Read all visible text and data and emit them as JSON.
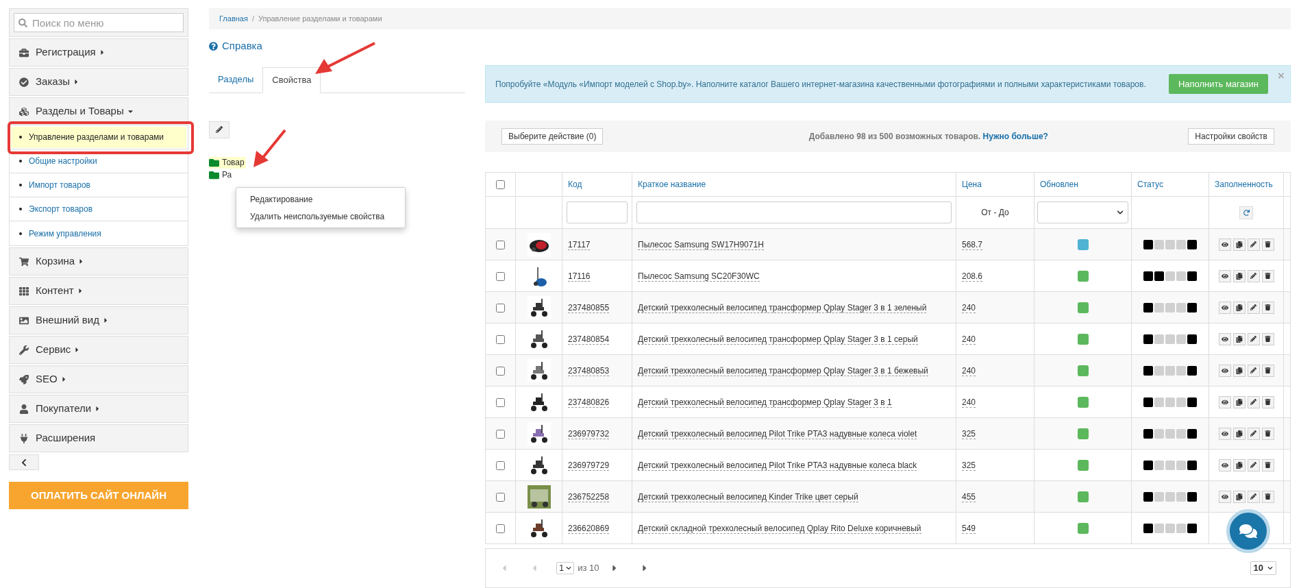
{
  "sidebar": {
    "search_placeholder": "Поиск по меню",
    "items": [
      {
        "label": "Регистрация",
        "expanded": false
      },
      {
        "label": "Заказы",
        "expanded": false
      },
      {
        "label": "Разделы и Товары",
        "expanded": true,
        "children": [
          {
            "label": "Управление разделами и товарами",
            "selected": true
          },
          {
            "label": "Общие настройки",
            "selected": false
          },
          {
            "label": "Импорт товаров",
            "selected": false
          },
          {
            "label": "Экспорт товаров",
            "selected": false
          },
          {
            "label": "Режим управления",
            "selected": false
          }
        ]
      },
      {
        "label": "Корзина",
        "expanded": false
      },
      {
        "label": "Контент",
        "expanded": false
      },
      {
        "label": "Внешний вид",
        "expanded": false
      },
      {
        "label": "Сервис",
        "expanded": false
      },
      {
        "label": "SEO",
        "expanded": false
      },
      {
        "label": "Покупатели",
        "expanded": false
      },
      {
        "label": "Расширения"
      }
    ],
    "pay_button": "ОПЛАТИТЬ САЙТ ОНЛАЙН"
  },
  "breadcrumb": {
    "separator": "/",
    "items": [
      "Главная",
      "Управление разделами и товарами"
    ]
  },
  "help_link": "Справка",
  "tabs": [
    {
      "label": "Разделы",
      "selected": false
    },
    {
      "label": "Свойства",
      "selected": true
    }
  ],
  "tree": [
    {
      "label": "Товар",
      "selected": true
    },
    {
      "label": "Ра",
      "selected": false
    }
  ],
  "context_menu": [
    "Редактирование",
    "Удалить неиспользуемые свойства"
  ],
  "banner": {
    "text": "Попробуйте «Модуль «Импорт моделей с Shop.by». Наполните каталог Вашего интернет-магазина качественными фотографиями и полными характеристиками товаров.",
    "button": "Наполнить магазин",
    "close": "×"
  },
  "action_bar": {
    "action_button": "Выберите действие (0)",
    "info": "Добавлено 98 из 500 возможных товаров.",
    "link": "Нужно больше?",
    "settings_button": "Настройки свойств"
  },
  "table": {
    "columns": [
      "Код",
      "Краткое название",
      "Цена",
      "Обновлен",
      "Статус",
      "Заполненность"
    ],
    "select_all_checked": false,
    "price_filter": "От - До",
    "rows": [
      {
        "checked": false,
        "code": "17117",
        "name": "Пылесос Samsung SW17H9071H",
        "price": "568.7",
        "color": "#4fb3d3",
        "status": [
          true,
          false,
          false,
          false,
          true
        ]
      },
      {
        "checked": false,
        "code": "17116",
        "name": "Пылесос Samsung SC20F30WC",
        "price": "208.6",
        "color": "#5cb85c",
        "status": [
          true,
          true,
          false,
          false,
          true
        ]
      },
      {
        "checked": false,
        "code": "237480855",
        "name": "Детский трехколесный велосипед трансформер Qplay Stager 3 в 1 зеленый",
        "price": "240",
        "color": "#5cb85c",
        "status": [
          true,
          false,
          false,
          false,
          true
        ]
      },
      {
        "checked": false,
        "code": "237480854",
        "name": "Детский трехколесный велосипед трансформер Qplay Stager 3 в 1 серый",
        "price": "240",
        "color": "#5cb85c",
        "status": [
          true,
          false,
          false,
          false,
          true
        ]
      },
      {
        "checked": false,
        "code": "237480853",
        "name": "Детский трехколесный велосипед трансформер Qplay Stager 3 в 1 бежевый",
        "price": "240",
        "color": "#5cb85c",
        "status": [
          true,
          false,
          false,
          false,
          true
        ]
      },
      {
        "checked": false,
        "code": "237480826",
        "name": "Детский трехколесный велосипед трансформер Qplay Stager 3 в 1",
        "price": "240",
        "color": "#5cb85c",
        "status": [
          true,
          false,
          false,
          false,
          true
        ]
      },
      {
        "checked": false,
        "code": "236979732",
        "name": "Детский трехколесный велосипед Pilot Trike PTA3 надувные колеса violet",
        "price": "325",
        "color": "#5cb85c",
        "status": [
          true,
          false,
          false,
          false,
          true
        ]
      },
      {
        "checked": false,
        "code": "236979729",
        "name": "Детский трехколесный велосипед Pilot Trike PTA3 надувные колеса black",
        "price": "325",
        "color": "#5cb85c",
        "status": [
          true,
          false,
          false,
          false,
          true
        ]
      },
      {
        "checked": false,
        "code": "236752258",
        "name": "Детский трехколесный велосипед Kinder Trike цвет серый",
        "price": "455",
        "color": "#5cb85c",
        "status": [
          true,
          false,
          false,
          false,
          true
        ]
      },
      {
        "checked": false,
        "code": "236620869",
        "name": "Детский складной трехколесный велосипед Qplay Rito Deluxe коричневый",
        "price": "549",
        "color": "#5cb85c",
        "status": [
          true,
          false,
          false,
          false,
          true
        ]
      }
    ]
  },
  "pagination": {
    "page": "1",
    "of": "из 10",
    "per_page": "10"
  }
}
